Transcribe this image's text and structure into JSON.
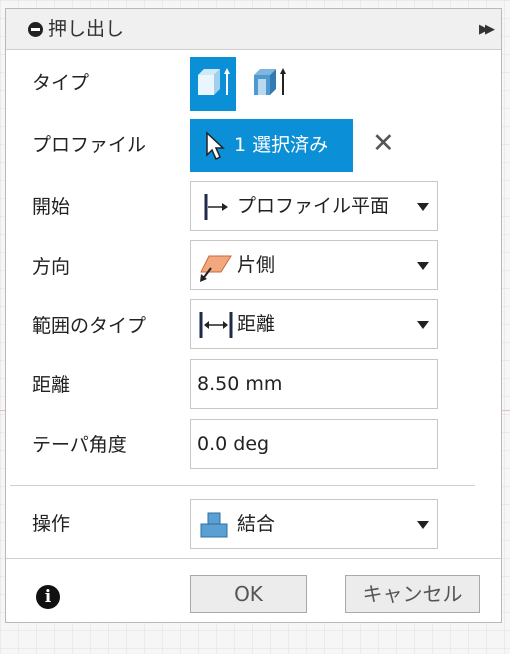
{
  "dialog": {
    "title": "押し出し",
    "rows": {
      "type_label": "タイプ",
      "profile_label": "プロファイル",
      "start_label": "開始",
      "direction_label": "方向",
      "extent_label": "範囲のタイプ",
      "distance_label": "距離",
      "taper_label": "テーパ角度",
      "operation_label": "操作"
    },
    "profile_button_label": "1 選択済み",
    "start_value": "プロファイル平面",
    "direction_value": "片側",
    "extent_value": "距離",
    "distance_value": "8.50 mm",
    "taper_value": "0.0 deg",
    "operation_value": "結合",
    "ok_label": "OK",
    "cancel_label": "キャンセル",
    "info_glyph": "i"
  },
  "icons": {
    "title": "minus-circle-icon",
    "expand": "double-arrow-icon",
    "type_solid": "solid-extrude-icon",
    "type_thin": "thin-extrude-icon",
    "cursor": "cursor-arrow-icon",
    "clear": "close-icon",
    "start": "profile-plane-icon",
    "direction": "one-side-icon",
    "extent": "distance-icon",
    "operation": "join-icon",
    "info": "info-icon"
  },
  "colors": {
    "accent": "#0b8fd6",
    "icon_blue": "#4e9ad0",
    "direction_icon_fill": "#f3a77c"
  }
}
